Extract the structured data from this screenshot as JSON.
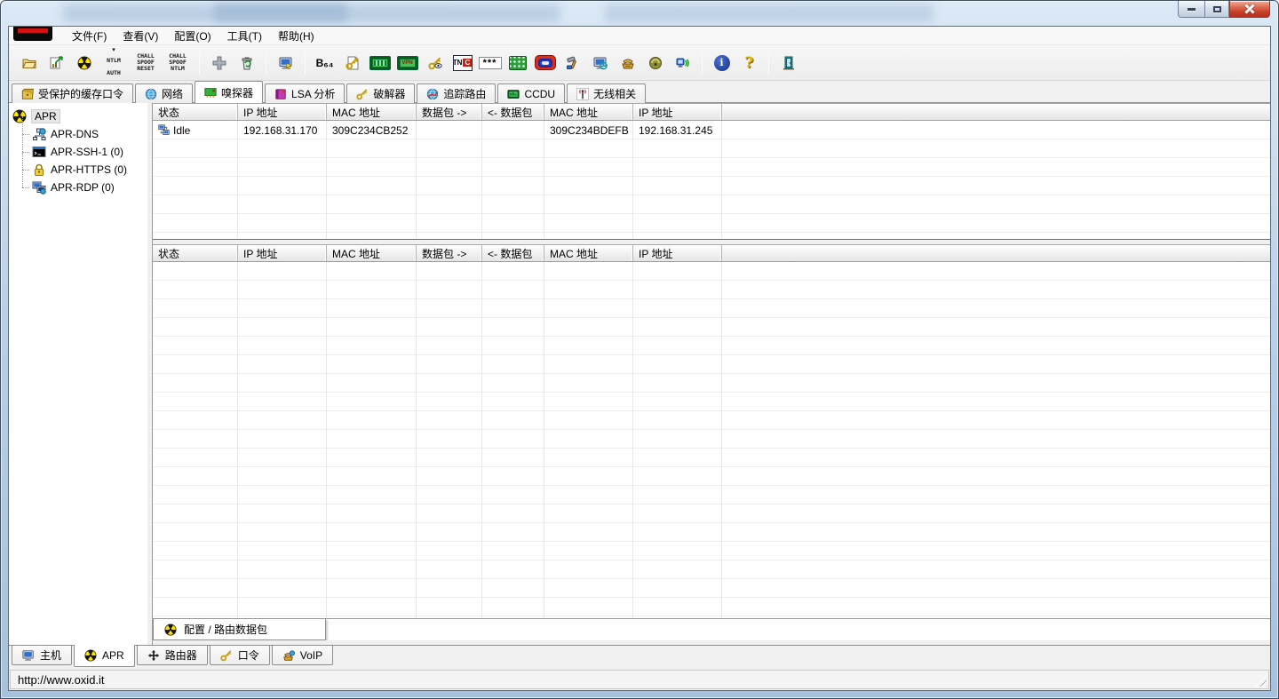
{
  "colors": {
    "titlebar_glass": "#b9d0e8",
    "close_button_red": "#c63d26",
    "chrome_bg": "#f0f0f0",
    "tab_border": "#8e8e8e",
    "grid_line": "#ededed",
    "lcd_green": "#46c15e",
    "radiation_yellow": "#ffe400",
    "selection_bg": "#e7e7e7"
  },
  "menu": {
    "items": [
      "文件(F)",
      "查看(V)",
      "配置(O)",
      "工具(T)",
      "帮助(H)"
    ]
  },
  "toolbar": {
    "glyphs": {
      "down_arrow": "▾",
      "ntlm_auth": "NTLM\nAUTH",
      "chall_spoof_reset": "CHALL\nSPOOF\nRESET",
      "chall_spoof_ntlm": "CHALL\nSPOOF\nNTLM",
      "plus": "+",
      "base64": "B₆₄",
      "vpn": "VPN",
      "vnc_tn": "TN",
      "vnc_c": "C",
      "asterisks": "***",
      "info": "i",
      "help": "?"
    }
  },
  "tabs": {
    "active": "嗅探器",
    "items": [
      {
        "label": "受保护的缓存口令"
      },
      {
        "label": "网络"
      },
      {
        "label": "嗅探器"
      },
      {
        "label": "LSA 分析"
      },
      {
        "label": "破解器"
      },
      {
        "label": "追踪路由"
      },
      {
        "label": "CCDU"
      },
      {
        "label": "无线相关"
      }
    ]
  },
  "tree": {
    "root": {
      "label": "APR"
    },
    "items": [
      {
        "label": "APR-DNS"
      },
      {
        "label": "APR-SSH-1 (0)"
      },
      {
        "label": "APR-HTTPS (0)"
      },
      {
        "label": "APR-RDP (0)"
      }
    ]
  },
  "sniffer": {
    "columns": [
      "状态",
      "IP 地址",
      "MAC 地址",
      "数据包 ->",
      "<- 数据包",
      "MAC 地址",
      "IP 地址"
    ],
    "row": {
      "status": "Idle",
      "ip_left": "192.168.31.170",
      "mac_left": "309C234CB252",
      "packets_out": "",
      "packets_in": "",
      "mac_right": "309C234BDEFB",
      "ip_right": "192.168.31.245"
    },
    "sheet_tab": "配置 / 路由数据包"
  },
  "bottom_tabs": {
    "active": "APR",
    "items": [
      {
        "label": "主机"
      },
      {
        "label": "APR"
      },
      {
        "label": "路由器"
      },
      {
        "label": "口令"
      },
      {
        "label": "VoIP"
      }
    ]
  },
  "status_bar": {
    "url": "http://www.oxid.it"
  }
}
